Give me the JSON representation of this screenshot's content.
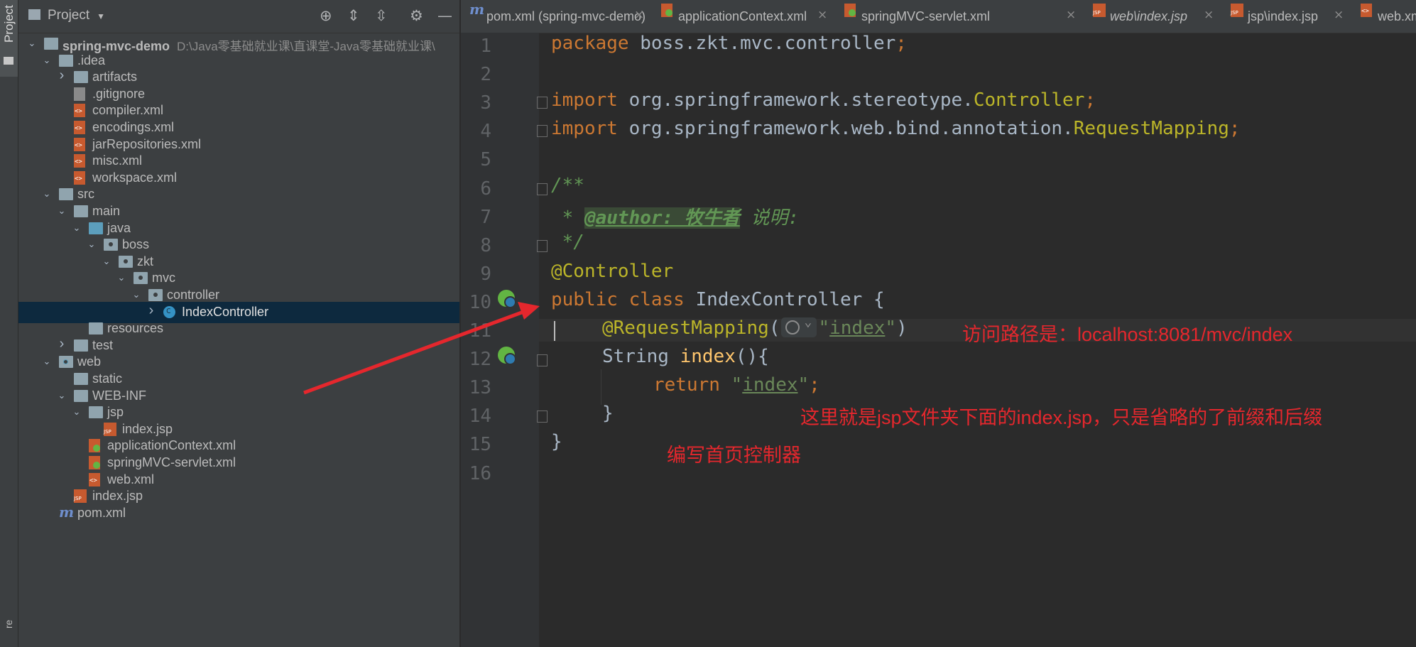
{
  "sidebar": {
    "project_tab": "Project",
    "bottom_tab": "re"
  },
  "panel": {
    "title": "Project",
    "tree": [
      {
        "label": "spring-mvc-demo",
        "hint": "D:\\Java零基础就业课\\直课堂-Java零基础就业课\\",
        "icon": "module-folder-icon",
        "arrow": "down",
        "bold": true
      },
      {
        "label": ".idea",
        "icon": "folder-icon",
        "arrow": "down"
      },
      {
        "label": "artifacts",
        "icon": "folder-icon",
        "arrow": "right"
      },
      {
        "label": ".gitignore",
        "icon": "gitignore-file-icon",
        "arrow": ""
      },
      {
        "label": "compiler.xml",
        "icon": "xml-file-icon",
        "arrow": ""
      },
      {
        "label": "encodings.xml",
        "icon": "xml-file-icon",
        "arrow": ""
      },
      {
        "label": "jarRepositories.xml",
        "icon": "xml-file-icon",
        "arrow": ""
      },
      {
        "label": "misc.xml",
        "icon": "xml-file-icon",
        "arrow": ""
      },
      {
        "label": "workspace.xml",
        "icon": "xml-file-icon",
        "arrow": ""
      },
      {
        "label": "src",
        "icon": "folder-icon",
        "arrow": "down"
      },
      {
        "label": "main",
        "icon": "folder-icon",
        "arrow": "down"
      },
      {
        "label": "java",
        "icon": "source-folder-icon",
        "arrow": "down"
      },
      {
        "label": "boss",
        "icon": "package-icon",
        "arrow": "down"
      },
      {
        "label": "zkt",
        "icon": "package-icon",
        "arrow": "down"
      },
      {
        "label": "mvc",
        "icon": "package-icon",
        "arrow": "down"
      },
      {
        "label": "controller",
        "icon": "package-icon",
        "arrow": "down"
      },
      {
        "label": "IndexController",
        "icon": "class-icon",
        "arrow": "right",
        "selected": true
      },
      {
        "label": "resources",
        "icon": "resources-folder-icon",
        "arrow": ""
      },
      {
        "label": "test",
        "icon": "folder-icon",
        "arrow": "right"
      },
      {
        "label": "web",
        "icon": "web-folder-icon",
        "arrow": "down"
      },
      {
        "label": "static",
        "icon": "folder-icon",
        "arrow": ""
      },
      {
        "label": "WEB-INF",
        "icon": "folder-icon",
        "arrow": "down"
      },
      {
        "label": "jsp",
        "icon": "folder-icon",
        "arrow": "down"
      },
      {
        "label": "index.jsp",
        "icon": "jsp-file-icon",
        "arrow": ""
      },
      {
        "label": "applicationContext.xml",
        "icon": "spring-xml-file-icon",
        "arrow": ""
      },
      {
        "label": "springMVC-servlet.xml",
        "icon": "spring-xml-file-icon",
        "arrow": ""
      },
      {
        "label": "web.xml",
        "icon": "xml-file-icon",
        "arrow": ""
      },
      {
        "label": "index.jsp",
        "icon": "jsp-file-icon",
        "arrow": ""
      },
      {
        "label": "pom.xml",
        "icon": "maven-file-icon",
        "arrow": ""
      }
    ]
  },
  "tabs": [
    {
      "label": "pom.xml (spring-mvc-demo)",
      "icon": "maven-file-icon"
    },
    {
      "label": "applicationContext.xml",
      "icon": "spring-xml-file-icon"
    },
    {
      "label": "springMVC-servlet.xml",
      "icon": "spring-xml-file-icon"
    },
    {
      "label": "web\\index.jsp",
      "icon": "jsp-file-icon",
      "italic": true
    },
    {
      "label": "jsp\\index.jsp",
      "icon": "jsp-file-icon"
    },
    {
      "label": "web.xm",
      "icon": "xml-file-icon"
    }
  ],
  "editor": {
    "line_numbers": [
      "1",
      "2",
      "3",
      "4",
      "5",
      "6",
      "7",
      "8",
      "9",
      "10",
      "11",
      "12",
      "13",
      "14",
      "15",
      "16"
    ],
    "code": {
      "l1_kw": "package",
      "l1_rest": " boss.zkt.mvc.controller",
      "l1_semi": ";",
      "l3_kw": "import",
      "l3_rest": " org.springframework.stereotype.",
      "l3_cls": "Controller",
      "l3_semi": ";",
      "l4_kw": "import",
      "l4_rest": " org.springframework.web.bind.annotation.",
      "l4_cls": "RequestMapping",
      "l4_semi": ";",
      "l6": "/**",
      "l7_star": " * ",
      "l7_tag": "@author: 牧牛者",
      "l7_text": " 说明:",
      "l8": " */",
      "l9": "@Controller",
      "l10_kw": "public class",
      "l10_rest": " IndexController {",
      "l11_an": "@RequestMapping",
      "l11_open": "(",
      "l11_q1": "\"",
      "l11_val": "index",
      "l11_q2": "\"",
      "l11_close": ")",
      "l12_type": "String ",
      "l12_fn": "index",
      "l12_rest": "(){",
      "l13_kw": "return ",
      "l13_q1": "\"",
      "l13_val": "index",
      "l13_q2": "\"",
      "l13_semi": ";",
      "l14": "}",
      "l15": "}"
    }
  },
  "annotations": {
    "path_note": "访问路径是：localhost:8081/mvc/index",
    "return_note": "这里就是jsp文件夹下面的index.jsp，只是省略的了前缀和后缀",
    "class_note": "编写首页控制器"
  },
  "colors": {
    "annotation_red": "#e5272d",
    "keyword": "#cc7832",
    "string": "#6a8759",
    "selection": "#0d293e"
  }
}
